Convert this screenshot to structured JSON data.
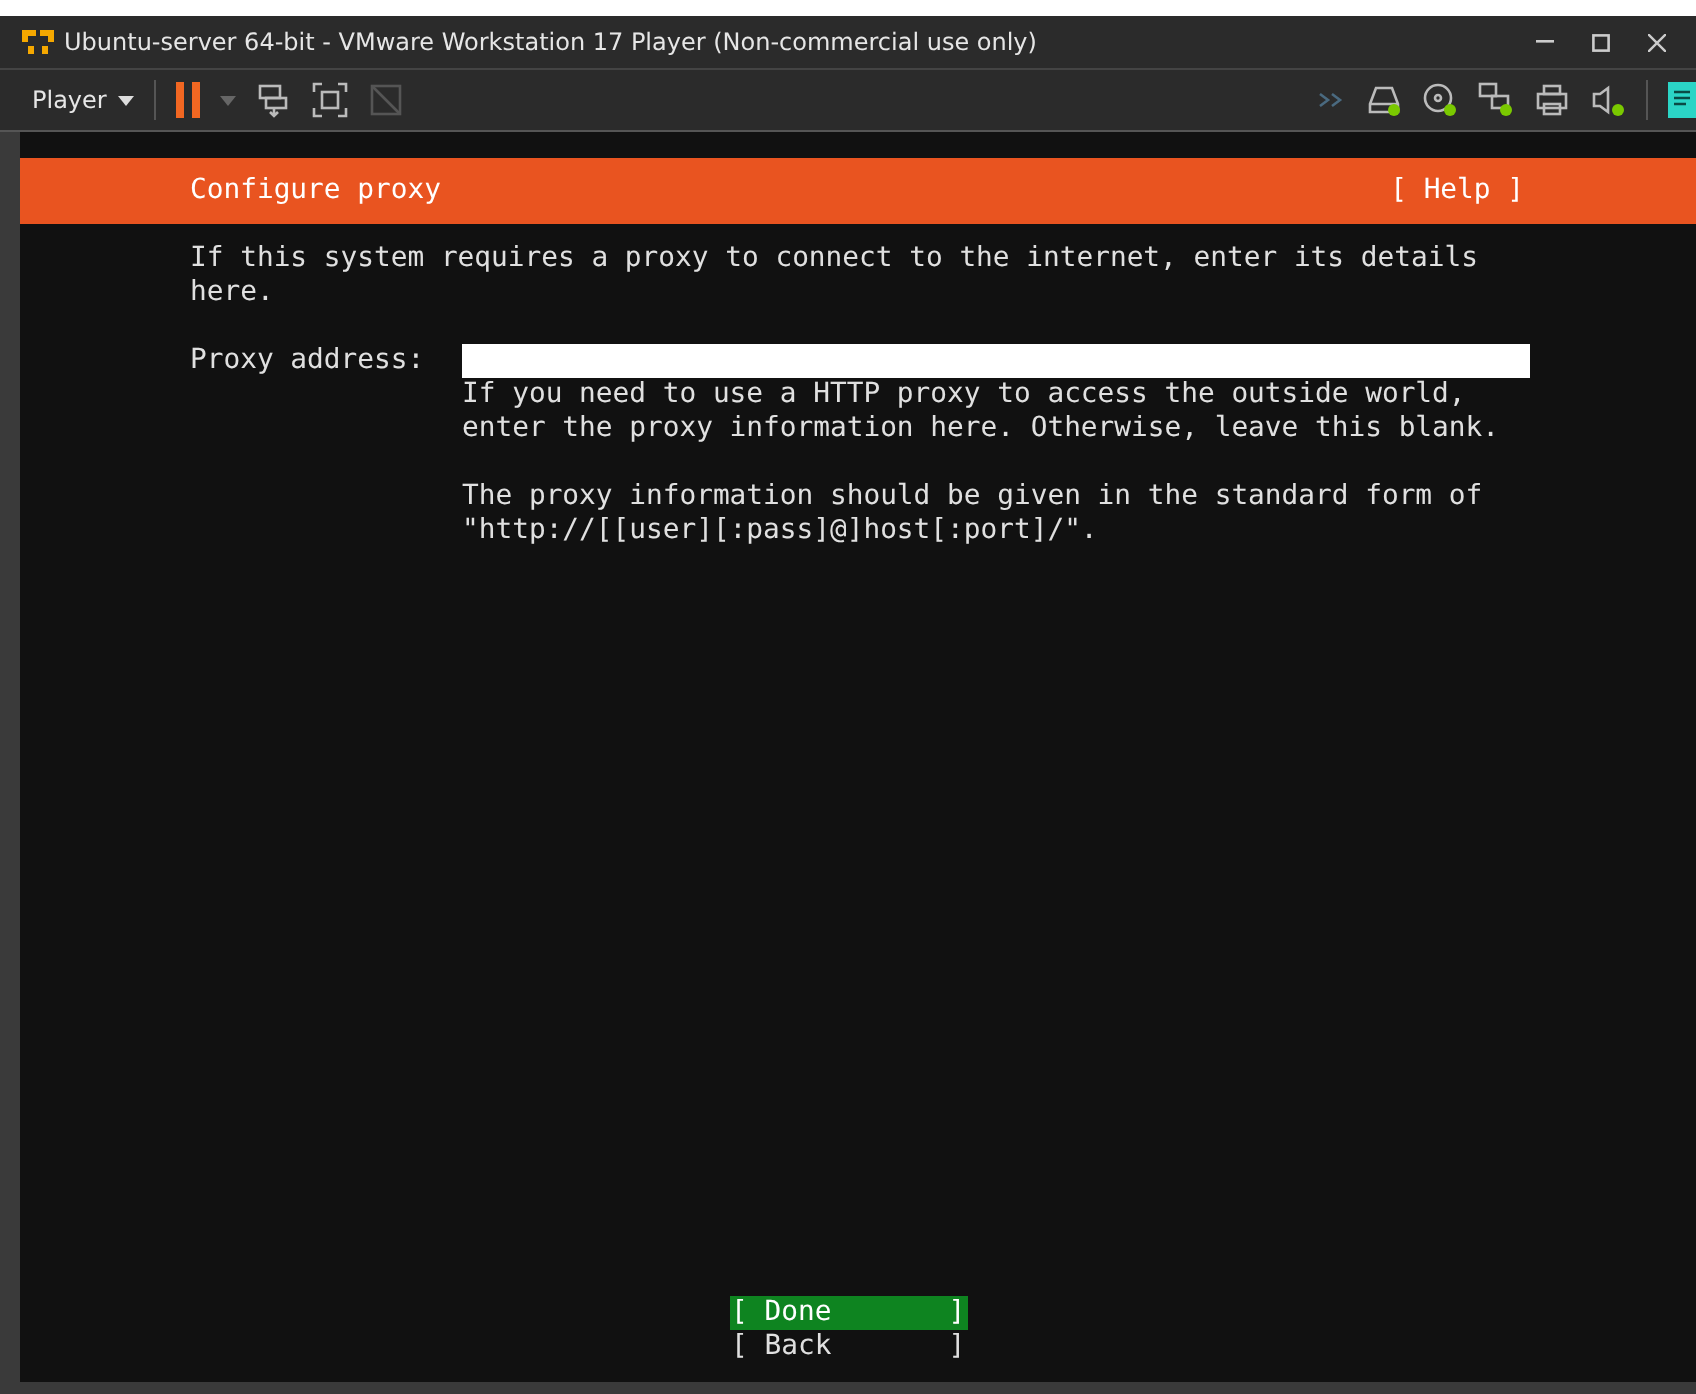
{
  "window": {
    "title": "Ubuntu-server 64-bit - VMware Workstation 17 Player (Non-commercial use only)"
  },
  "toolbar": {
    "menu": "Player"
  },
  "screen": {
    "header": "Configure proxy",
    "help": "[ Help ]",
    "intro": "If this system requires a proxy to connect to the internet, enter its details\nhere.",
    "field_label": "Proxy address:",
    "help_text": [
      "If you need to use a HTTP proxy to access the outside world,\nenter the proxy information here. Otherwise, leave this blank.",
      "The proxy information should be given in the standard form of\n\"http://[[user][:pass]@]host[:port]/\"."
    ],
    "buttons": [
      {
        "label": "[ Done       ]",
        "selected": true
      },
      {
        "label": "[ Back       ]",
        "selected": false
      }
    ]
  }
}
